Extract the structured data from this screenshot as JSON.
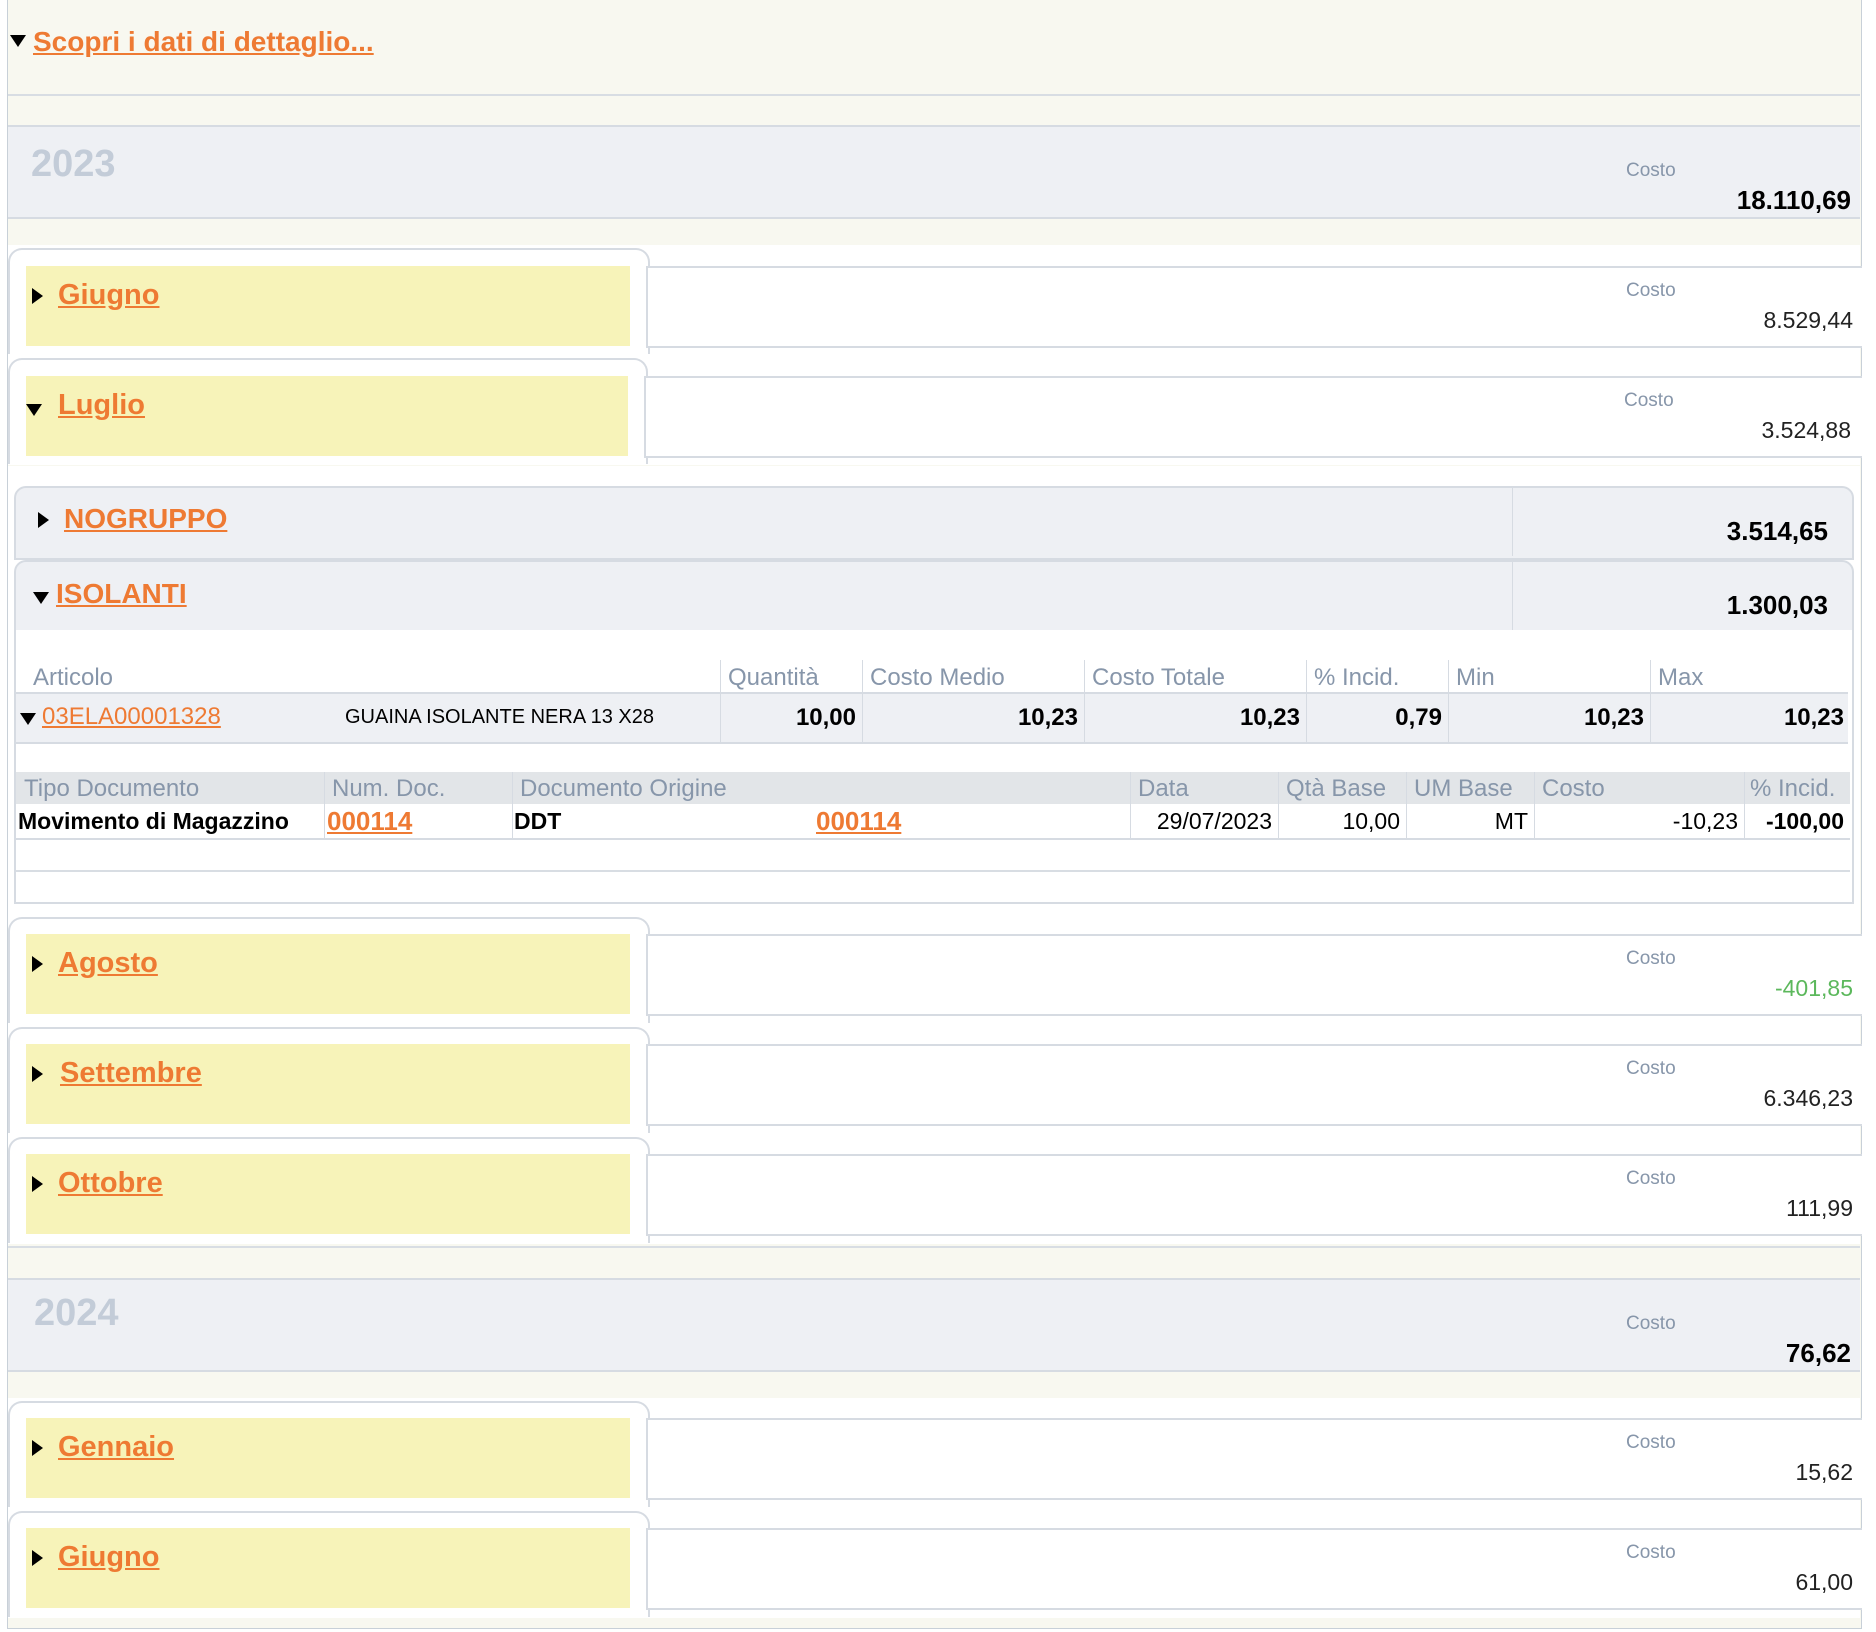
{
  "header": {
    "discover_link": "Scopri i dati di dettaglio..."
  },
  "costo_label": "Costo",
  "years": [
    {
      "year": "2023",
      "total": "18.110,69",
      "months": [
        {
          "name": "Giugno",
          "value": "8.529,44"
        },
        {
          "name": "Luglio",
          "value": "3.524,88"
        },
        {
          "name": "Agosto",
          "value": "-401,85"
        },
        {
          "name": "Settembre",
          "value": "6.346,23"
        },
        {
          "name": "Ottobre",
          "value": "111,99"
        }
      ]
    },
    {
      "year": "2024",
      "total": "76,62",
      "months": [
        {
          "name": "Gennaio",
          "value": "15,62"
        },
        {
          "name": "Giugno",
          "value": "61,00"
        }
      ]
    }
  ],
  "groups": [
    {
      "name": "NOGRUPPO",
      "value": "3.514,65"
    },
    {
      "name": "ISOLANTI",
      "value": "1.300,03"
    }
  ],
  "article_table": {
    "headers": [
      "Articolo",
      "Quantità",
      "Costo Medio",
      "Costo Totale",
      "% Incid.",
      "Min",
      "Max"
    ],
    "row": {
      "code": "03ELA00001328",
      "description": "GUAINA ISOLANTE NERA 13 X28",
      "quantita": "10,00",
      "costo_medio": "10,23",
      "costo_totale": "10,23",
      "incid": "0,79",
      "min": "10,23",
      "max": "10,23"
    }
  },
  "doc_table": {
    "headers": [
      "Tipo Documento",
      "Num. Doc.",
      "Documento Origine",
      "Data",
      "Qtà Base",
      "UM Base",
      "Costo",
      "% Incid."
    ],
    "row": {
      "tipo": "Movimento di Magazzino",
      "num": "000114",
      "origine_tipo": "DDT",
      "origine_num": "000114",
      "data": "29/07/2023",
      "qta": "10,00",
      "um": "MT",
      "costo": "-10,23",
      "incid": "-100,00"
    }
  }
}
